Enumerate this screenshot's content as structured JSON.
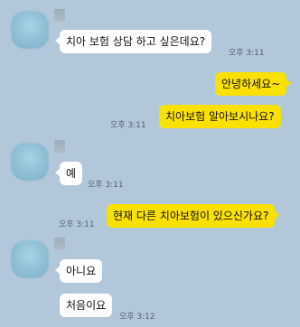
{
  "messages": [
    {
      "text": "치아 보험 상담 하고 싶은데요?",
      "time": "오후 3:11"
    },
    {
      "text": "안녕하세요~"
    },
    {
      "text": "치아보험 알아보시나요?",
      "time": "오후 3:11"
    },
    {
      "text": "예",
      "time": "오후 3:11"
    },
    {
      "text": "현재 다른 치아보험이 있으신가요?",
      "time": "오후 3:11"
    },
    {
      "text": "아니요"
    },
    {
      "text": "처음이요",
      "time": "오후 3:12"
    }
  ],
  "colors": {
    "background": "#b2c7d9",
    "incoming_bubble": "#ffffff",
    "outgoing_bubble": "#fae100"
  }
}
